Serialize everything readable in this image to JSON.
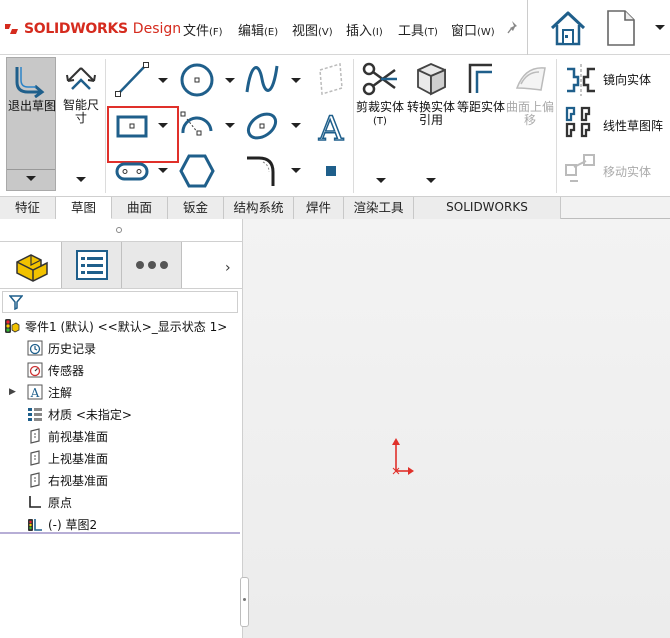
{
  "app": {
    "brand": "SOLIDWORKS",
    "edition": "Design"
  },
  "menu": [
    {
      "label": "文件",
      "key": "(F)"
    },
    {
      "label": "编辑",
      "key": "(E)"
    },
    {
      "label": "视图",
      "key": "(V)"
    },
    {
      "label": "插入",
      "key": "(I)"
    },
    {
      "label": "工具",
      "key": "(T)"
    },
    {
      "label": "窗口",
      "key": "(W)"
    }
  ],
  "ribbon": {
    "exit_sketch": "退出草图",
    "smart_dimension": "智能尺寸",
    "trim": "剪裁实体",
    "trim_key": "(T)",
    "convert": "转换实体引用",
    "offset": "等距实体",
    "offset_surface": "曲面上偏移",
    "mirror": "镜向实体",
    "linear_pattern": "线性草图阵",
    "move": "移动实体"
  },
  "tabs": [
    "特征",
    "草图",
    "曲面",
    "钣金",
    "结构系统",
    "焊件",
    "渲染工具",
    "SOLIDWORKS Inspection"
  ],
  "active_tab": "草图",
  "tree": {
    "root": "零件1 (默认) <<默认>_显示状态 1>",
    "items": [
      "历史记录",
      "传感器",
      "注解",
      "材质 <未指定>",
      "前视基准面",
      "上视基准面",
      "右视基准面",
      "原点",
      "(-) 草图2"
    ]
  },
  "colors": {
    "brand_red": "#d52b1e",
    "tool_blue": "#1f5f8b",
    "highlight_red": "#e0302a"
  }
}
